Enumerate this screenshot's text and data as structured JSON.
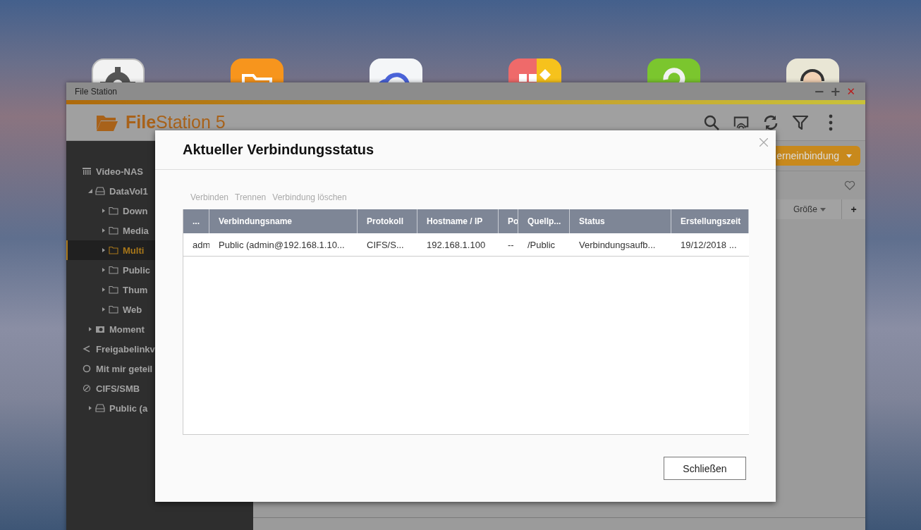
{
  "window": {
    "title": "File Station",
    "controls": [
      {
        "kind": "minimize",
        "glyph": "−"
      },
      {
        "kind": "maximize",
        "glyph": "+"
      },
      {
        "kind": "close",
        "glyph": "✕"
      }
    ]
  },
  "app_header": {
    "title": "**File**Station 5"
  },
  "sidebar": {
    "items": [
      {
        "label": "Video-NAS",
        "kind": "nas",
        "selected": false,
        "children": [
          {
            "label": "DataVol1",
            "kind": "volume",
            "expanded": true,
            "selected": false,
            "children": [
              {
                "label": "Down",
                "kind": "folder",
                "expanded": false,
                "selected": false
              },
              {
                "label": "Media",
                "kind": "folder",
                "expanded": false,
                "selected": false
              },
              {
                "label": "Multi",
                "kind": "folder",
                "expanded": false,
                "selected": true
              },
              {
                "label": "Public",
                "kind": "folder",
                "expanded": false,
                "selected": false
              },
              {
                "label": "Thum",
                "kind": "folder",
                "expanded": false,
                "selected": false
              },
              {
                "label": "Web",
                "kind": "folder",
                "expanded": false,
                "selected": false
              }
            ]
          },
          {
            "label": "Moment",
            "kind": "snapshot",
            "expanded": false,
            "selected": false
          }
        ]
      },
      {
        "label": "Freigabelinkv",
        "kind": "share-link",
        "selected": false
      },
      {
        "label": "Mit mir geteil",
        "kind": "shared",
        "selected": false
      },
      {
        "label": "CIFS/SMB",
        "kind": "remote",
        "selected": false,
        "children": [
          {
            "label": "Public (a",
            "kind": "volume",
            "expanded": false,
            "selected": false
          }
        ]
      }
    ]
  },
  "toolbar": {
    "button": "erneinbindung"
  },
  "file_list": {
    "columns": [
      "Größe"
    ],
    "add": "+"
  },
  "dialog": {
    "title": "Aktueller Verbindungsstatus",
    "actions": [
      {
        "label": "Verbinden",
        "disabled": true
      },
      {
        "label": "Trennen",
        "disabled": true
      },
      {
        "label": "Verbindung löschen",
        "disabled": true
      }
    ],
    "table": {
      "columns": [
        "...",
        "Verbindungsname",
        "Protokoll",
        "Hostname / IP",
        "Po",
        "Quellp...",
        "Status",
        "Erstellungszeit"
      ],
      "rows": [
        [
          "adm",
          "Public (admin@192.168.1.10...",
          "CIFS/S...",
          "192.168.1.100",
          "--",
          "/Public",
          "Verbindungsaufb...",
          "19/12/2018 ..."
        ]
      ]
    },
    "button": "Schließen"
  }
}
